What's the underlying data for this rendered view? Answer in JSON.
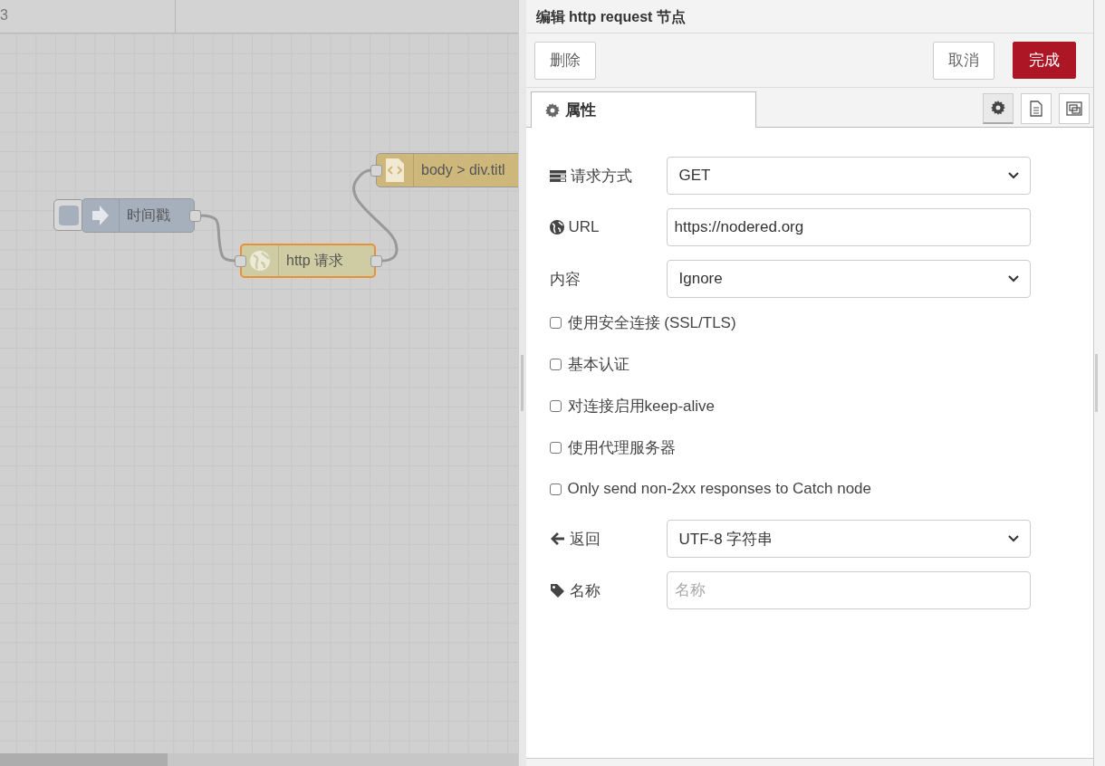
{
  "workspace": {
    "tabs": [
      {
        "label": "3"
      }
    ],
    "nodes": [
      {
        "kind": "inject",
        "label": "时间戳",
        "selected": false
      },
      {
        "kind": "http",
        "label": "http 请求",
        "selected": true
      },
      {
        "kind": "html",
        "label": "body > div.titl",
        "selected": false
      }
    ]
  },
  "tray": {
    "title": "编辑 http request 节点",
    "buttons": [
      {
        "kind": "delete",
        "label": "删除"
      },
      {
        "kind": "cancel",
        "label": "取消"
      },
      {
        "kind": "done",
        "label": "完成"
      }
    ],
    "tabs": [
      {
        "label": "属性",
        "selected": true
      }
    ],
    "tab_buttons": [
      {
        "kind": "settings",
        "selected": true
      },
      {
        "kind": "description",
        "selected": false
      },
      {
        "kind": "appearance",
        "selected": false
      }
    ],
    "fields": [
      {
        "kind": "select",
        "label": "请求方式",
        "value": "GET"
      },
      {
        "kind": "input",
        "label": "URL",
        "value": "https://nodered.org"
      },
      {
        "kind": "select",
        "label": "内容",
        "value": "Ignore"
      },
      {
        "kind": "checkbox",
        "label": "使用安全连接 (SSL/TLS)",
        "checked": false
      },
      {
        "kind": "checkbox",
        "label": "基本认证",
        "checked": false
      },
      {
        "kind": "checkbox",
        "label": "对连接启用keep-alive",
        "checked": false
      },
      {
        "kind": "checkbox",
        "label": "使用代理服务器",
        "checked": false
      },
      {
        "kind": "checkbox",
        "label": "Only send non-2xx responses to Catch node",
        "checked": false
      },
      {
        "kind": "select",
        "label": "返回",
        "value": "UTF-8 字符串"
      },
      {
        "kind": "input",
        "label": "名称",
        "placeholder": "名称"
      }
    ]
  }
}
